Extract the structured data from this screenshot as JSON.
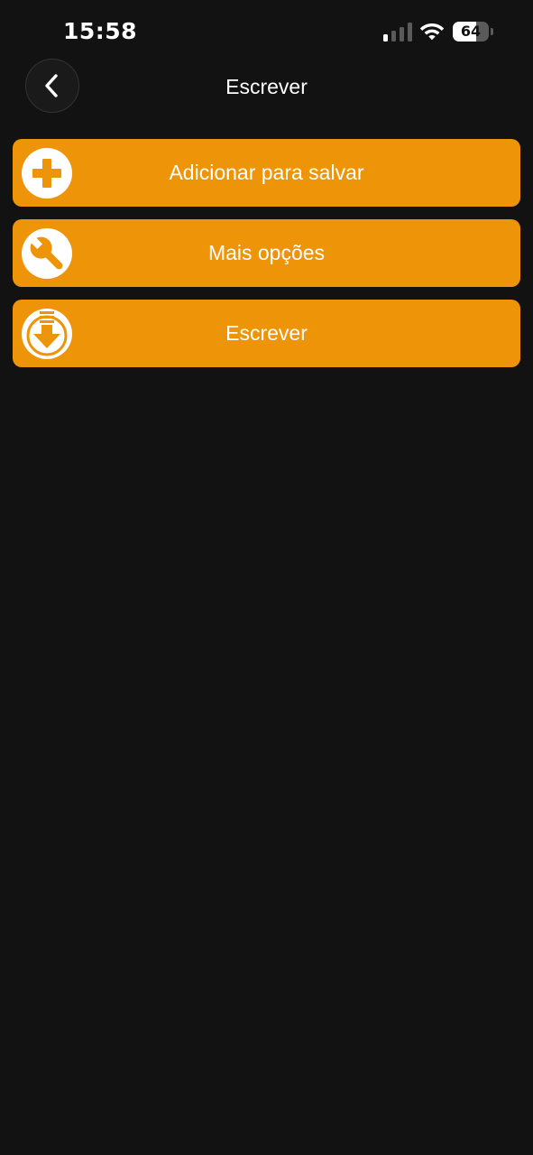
{
  "status_bar": {
    "time": "15:58",
    "battery_level": "64",
    "battery_fraction": 0.64,
    "icons": [
      "signal-icon",
      "wifi-icon",
      "battery-icon"
    ]
  },
  "header": {
    "title": "Escrever",
    "back_icon": "chevron-left-icon"
  },
  "menu": {
    "items": [
      {
        "label": "Adicionar para salvar",
        "icon": "plus-circle-icon"
      },
      {
        "label": "Mais opções",
        "icon": "wrench-icon"
      },
      {
        "label": "Escrever",
        "icon": "download-icon"
      }
    ]
  },
  "colors": {
    "background": "#121212",
    "accent": "#ee9408",
    "text": "#ffffff"
  }
}
